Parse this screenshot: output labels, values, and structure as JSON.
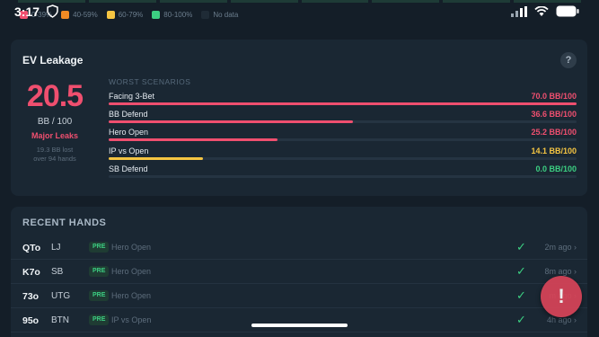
{
  "status_bar": {
    "time": "3:17"
  },
  "legend": [
    {
      "label": "0-39%",
      "color": "#ef4f6f"
    },
    {
      "label": "40-59%",
      "color": "#f08a24"
    },
    {
      "label": "60-79%",
      "color": "#f5c542"
    },
    {
      "label": "80-100%",
      "color": "#3ccf82"
    },
    {
      "label": "No data",
      "color": "#1f2b36"
    }
  ],
  "ev_leakage": {
    "title": "EV Leakage",
    "help_label": "?",
    "score": "20.5",
    "unit": "BB / 100",
    "severity": "Major Leaks",
    "lost_line1": "19.3 BB lost",
    "lost_line2": "over 94 hands",
    "worst_header": "WORST SCENARIOS",
    "scenarios": [
      {
        "label": "Facing 3-Bet",
        "value": "70.0 BB/100",
        "fill": 1.0,
        "color": "#ef4f6f"
      },
      {
        "label": "BB Defend",
        "value": "36.6 BB/100",
        "fill": 0.523,
        "color": "#ef4f6f"
      },
      {
        "label": "Hero Open",
        "value": "25.2 BB/100",
        "fill": 0.36,
        "color": "#ef4f6f"
      },
      {
        "label": "IP vs Open",
        "value": "14.1 BB/100",
        "fill": 0.201,
        "color": "#f5c542"
      },
      {
        "label": "SB Defend",
        "value": "0.0 BB/100",
        "fill": 0.0,
        "color": "#3ccf82"
      }
    ]
  },
  "recent_hands": {
    "title": "RECENT HANDS",
    "rows": [
      {
        "hand": "QTo",
        "position": "LJ",
        "street": "PRE",
        "scenario": "Hero Open",
        "time": "2m ago ›"
      },
      {
        "hand": "K7o",
        "position": "SB",
        "street": "PRE",
        "scenario": "Hero Open",
        "time": "8m ago ›"
      },
      {
        "hand": "73o",
        "position": "UTG",
        "street": "PRE",
        "scenario": "Hero Open",
        "time": "m ago ›"
      },
      {
        "hand": "95o",
        "position": "BTN",
        "street": "PRE",
        "scenario": "IP vs Open",
        "time": "4h ago ›"
      }
    ]
  },
  "fab": {
    "label": "!"
  }
}
